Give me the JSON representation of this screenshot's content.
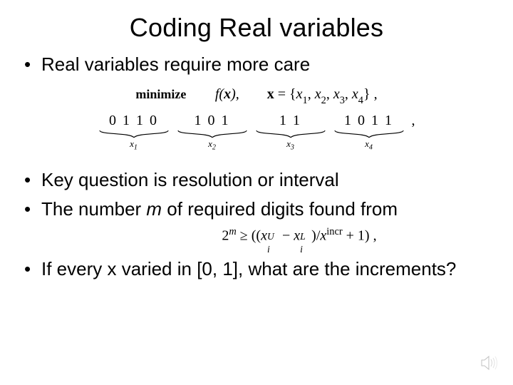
{
  "title": "Coding Real variables",
  "bullets": {
    "b1": "Real variables require more care",
    "b2": "Key question is resolution or interval",
    "b3_a": "The number ",
    "b3_m": "m",
    "b3_b": " of required digits found from",
    "b4": "If every x varied in [0, 1], what are the increments?"
  },
  "math": {
    "minimize": "minimize",
    "fx": "f(x),",
    "xset_prefix": "x = {",
    "xset_items": "x₁, x₂, x₃, x₄",
    "xset_suffix": "} ,",
    "groups": [
      {
        "bits": "0 1 1 0",
        "label": "x",
        "labelSub": "1"
      },
      {
        "bits": "1 0 1",
        "label": "x",
        "labelSub": "2"
      },
      {
        "bits": "1 1",
        "label": "x",
        "labelSub": "3"
      },
      {
        "bits": "1 0 1 1",
        "label": "x",
        "labelSub": "4"
      }
    ],
    "tail": ","
  },
  "inequality": {
    "lhs_base": "2",
    "lhs_exp": "m",
    "geq": " ≥ ((",
    "xi": "x",
    "sup_U": "U",
    "sub_i": "i",
    "minus": " − ",
    "sup_L": "L",
    "close1": ")/",
    "xincr_x": "x",
    "xincr_sup": "incr",
    "plus1": " + 1) ,"
  }
}
